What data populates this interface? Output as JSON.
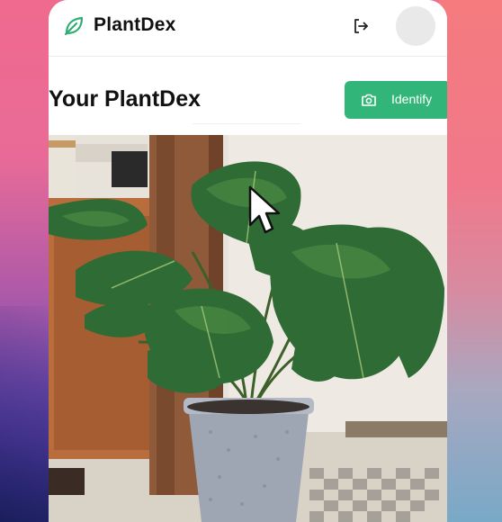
{
  "header": {
    "app_title": "PlantDex",
    "logo_icon": "leaf-icon",
    "logout_icon": "logout-icon"
  },
  "main": {
    "section_title": "Your PlantDex",
    "identify_label": "Identify",
    "identify_icon": "camera-icon"
  },
  "colors": {
    "accent": "#31b579",
    "logo_green": "#2fae74"
  }
}
